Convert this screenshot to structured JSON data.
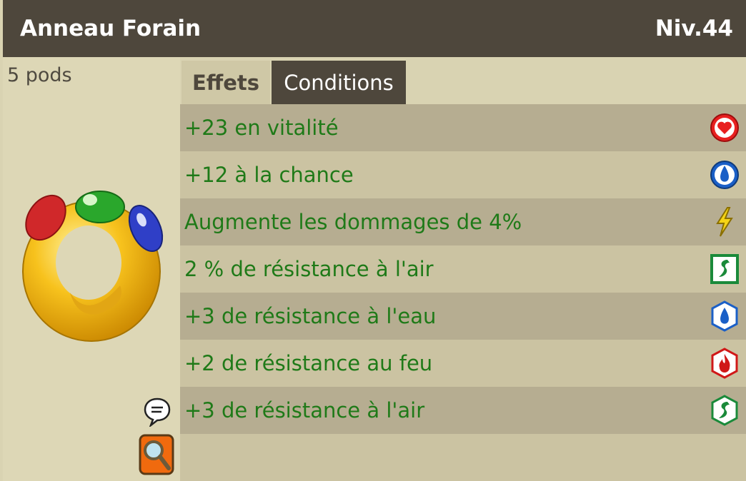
{
  "header": {
    "title": "Anneau Forain",
    "level": "Niv.44"
  },
  "item": {
    "weight": "5 pods",
    "image_icon": "ring-icon"
  },
  "tabs": [
    {
      "label": "Effets",
      "active": true
    },
    {
      "label": "Conditions",
      "active": false
    }
  ],
  "effects": [
    {
      "text": "+23 en vitalité",
      "icon": "heart-icon"
    },
    {
      "text": "+12 à la chance",
      "icon": "water-drop-icon"
    },
    {
      "text": "Augmente les dommages de 4%",
      "icon": "lightning-icon"
    },
    {
      "text": "2 % de résistance à l'air",
      "icon": "air-square-icon"
    },
    {
      "text": "+3 de résistance à l'eau",
      "icon": "water-hex-icon"
    },
    {
      "text": "+2 de résistance au feu",
      "icon": "fire-hex-icon"
    },
    {
      "text": "+3 de résistance à l'air",
      "icon": "air-hex-icon"
    }
  ],
  "actions": {
    "chat_icon": "speech-bubble-icon",
    "inspect_icon": "magnifier-icon"
  },
  "colors": {
    "header_bg": "#4e473c",
    "panel_bg": "#d9d3b2",
    "row_dark": "#b6ad91",
    "row_light": "#cbc3a2",
    "effect_text": "#1f7a18"
  }
}
